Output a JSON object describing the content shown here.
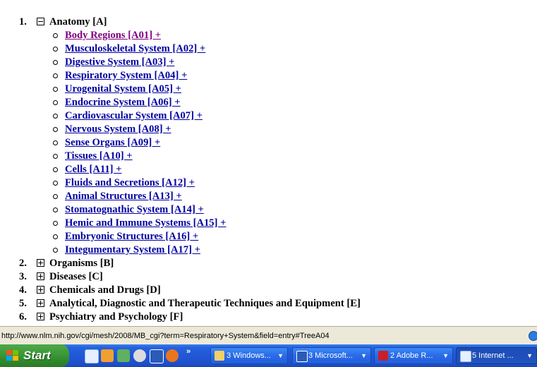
{
  "tree": [
    {
      "num": "1.",
      "expanded": true,
      "label": "Anatomy [A]"
    },
    {
      "num": "2.",
      "expanded": false,
      "label": "Organisms [B]"
    },
    {
      "num": "3.",
      "expanded": false,
      "label": "Diseases [C]"
    },
    {
      "num": "4.",
      "expanded": false,
      "label": "Chemicals and Drugs [D]"
    },
    {
      "num": "5.",
      "expanded": false,
      "label": "Analytical, Diagnostic and Therapeutic Techniques and Equipment [E]"
    },
    {
      "num": "6.",
      "expanded": false,
      "label": "Psychiatry and Psychology [F]"
    }
  ],
  "anatomy_children": [
    {
      "label": "Body Regions [A01]  +",
      "visited": true
    },
    {
      "label": "Musculoskeletal System [A02]  +"
    },
    {
      "label": "Digestive System [A03]  +"
    },
    {
      "label": "Respiratory System [A04]  +"
    },
    {
      "label": "Urogenital System [A05]  +"
    },
    {
      "label": "Endocrine System [A06]  +"
    },
    {
      "label": "Cardiovascular System [A07]  +"
    },
    {
      "label": "Nervous System [A08]  +"
    },
    {
      "label": "Sense Organs [A09]  +"
    },
    {
      "label": "Tissues [A10]  +"
    },
    {
      "label": "Cells [A11]  +"
    },
    {
      "label": "Fluids and Secretions [A12]  +"
    },
    {
      "label": "Animal Structures [A13]  +"
    },
    {
      "label": "Stomatognathic System [A14]  +"
    },
    {
      "label": "Hemic and Immune Systems [A15]  +"
    },
    {
      "label": "Embryonic Structures [A16]  +"
    },
    {
      "label": "Integumentary System [A17]  +"
    }
  ],
  "status_bar": {
    "url": "http://www.nlm.nih.gov/cgi/mesh/2008/MB_cgi?term=Respiratory+System&field=entry#TreeA04"
  },
  "taskbar": {
    "start_label": "Start",
    "quick_launch_icons": [
      "ie-icon",
      "media-icon",
      "messenger-icon",
      "player-icon",
      "word-icon",
      "firefox-icon"
    ],
    "chevron": "»",
    "tasks": [
      {
        "label": "3 Windows...",
        "icon": "folder-icon",
        "active": false
      },
      {
        "label": "3 Microsoft...",
        "icon": "word-icon",
        "active": false
      },
      {
        "label": "2 Adobe R...",
        "icon": "acrobat-icon",
        "active": false
      },
      {
        "label": "5 Internet ...",
        "icon": "ie-icon",
        "active": true
      }
    ]
  }
}
